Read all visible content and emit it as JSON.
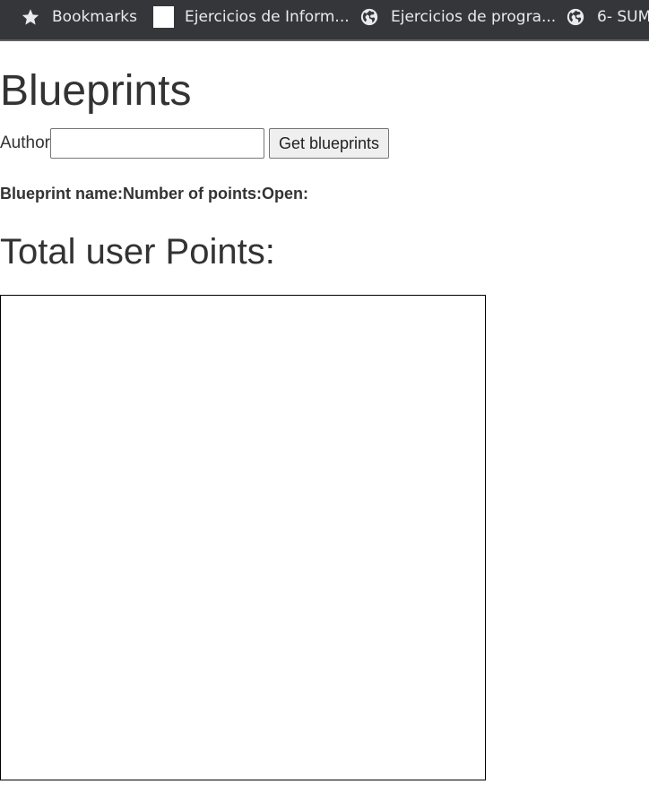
{
  "bookmarks_bar": {
    "items": [
      {
        "label": "Bookmarks",
        "icon": "star-icon"
      },
      {
        "label": "Ejercicios de Inform...",
        "icon": "blank-page-icon"
      },
      {
        "label": "Ejercicios de progra...",
        "icon": "globe-icon"
      },
      {
        "label": "6- SUM",
        "icon": "globe-icon"
      }
    ]
  },
  "page": {
    "title": "Blueprints",
    "author_label": "Author",
    "author_input_value": "",
    "author_input_placeholder": "",
    "get_button_label": "Get blueprints",
    "table_headers": [
      "Blueprint name:",
      "Number of points:",
      "Open:"
    ],
    "total_points_label": "Total user Points:",
    "total_points_value": ""
  },
  "colors": {
    "bookmarks_bar_bg": "#35363a",
    "text": "#333333",
    "canvas_border": "#000000"
  }
}
